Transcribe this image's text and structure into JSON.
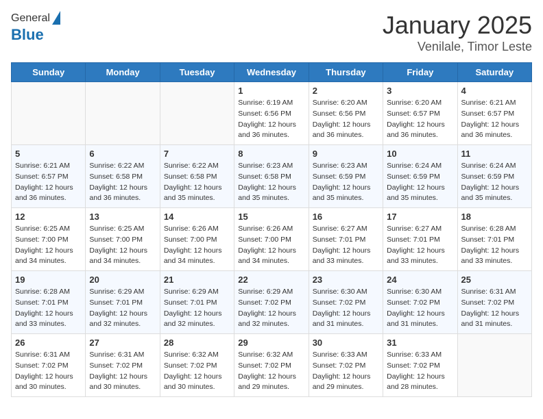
{
  "header": {
    "logo_line1": "General",
    "logo_line2": "Blue",
    "title": "January 2025",
    "subtitle": "Venilale, Timor Leste"
  },
  "weekdays": [
    "Sunday",
    "Monday",
    "Tuesday",
    "Wednesday",
    "Thursday",
    "Friday",
    "Saturday"
  ],
  "weeks": [
    [
      {
        "day": "",
        "info": ""
      },
      {
        "day": "",
        "info": ""
      },
      {
        "day": "",
        "info": ""
      },
      {
        "day": "1",
        "info": "Sunrise: 6:19 AM\nSunset: 6:56 PM\nDaylight: 12 hours\nand 36 minutes."
      },
      {
        "day": "2",
        "info": "Sunrise: 6:20 AM\nSunset: 6:56 PM\nDaylight: 12 hours\nand 36 minutes."
      },
      {
        "day": "3",
        "info": "Sunrise: 6:20 AM\nSunset: 6:57 PM\nDaylight: 12 hours\nand 36 minutes."
      },
      {
        "day": "4",
        "info": "Sunrise: 6:21 AM\nSunset: 6:57 PM\nDaylight: 12 hours\nand 36 minutes."
      }
    ],
    [
      {
        "day": "5",
        "info": "Sunrise: 6:21 AM\nSunset: 6:57 PM\nDaylight: 12 hours\nand 36 minutes."
      },
      {
        "day": "6",
        "info": "Sunrise: 6:22 AM\nSunset: 6:58 PM\nDaylight: 12 hours\nand 36 minutes."
      },
      {
        "day": "7",
        "info": "Sunrise: 6:22 AM\nSunset: 6:58 PM\nDaylight: 12 hours\nand 35 minutes."
      },
      {
        "day": "8",
        "info": "Sunrise: 6:23 AM\nSunset: 6:58 PM\nDaylight: 12 hours\nand 35 minutes."
      },
      {
        "day": "9",
        "info": "Sunrise: 6:23 AM\nSunset: 6:59 PM\nDaylight: 12 hours\nand 35 minutes."
      },
      {
        "day": "10",
        "info": "Sunrise: 6:24 AM\nSunset: 6:59 PM\nDaylight: 12 hours\nand 35 minutes."
      },
      {
        "day": "11",
        "info": "Sunrise: 6:24 AM\nSunset: 6:59 PM\nDaylight: 12 hours\nand 35 minutes."
      }
    ],
    [
      {
        "day": "12",
        "info": "Sunrise: 6:25 AM\nSunset: 7:00 PM\nDaylight: 12 hours\nand 34 minutes."
      },
      {
        "day": "13",
        "info": "Sunrise: 6:25 AM\nSunset: 7:00 PM\nDaylight: 12 hours\nand 34 minutes."
      },
      {
        "day": "14",
        "info": "Sunrise: 6:26 AM\nSunset: 7:00 PM\nDaylight: 12 hours\nand 34 minutes."
      },
      {
        "day": "15",
        "info": "Sunrise: 6:26 AM\nSunset: 7:00 PM\nDaylight: 12 hours\nand 34 minutes."
      },
      {
        "day": "16",
        "info": "Sunrise: 6:27 AM\nSunset: 7:01 PM\nDaylight: 12 hours\nand 33 minutes."
      },
      {
        "day": "17",
        "info": "Sunrise: 6:27 AM\nSunset: 7:01 PM\nDaylight: 12 hours\nand 33 minutes."
      },
      {
        "day": "18",
        "info": "Sunrise: 6:28 AM\nSunset: 7:01 PM\nDaylight: 12 hours\nand 33 minutes."
      }
    ],
    [
      {
        "day": "19",
        "info": "Sunrise: 6:28 AM\nSunset: 7:01 PM\nDaylight: 12 hours\nand 33 minutes."
      },
      {
        "day": "20",
        "info": "Sunrise: 6:29 AM\nSunset: 7:01 PM\nDaylight: 12 hours\nand 32 minutes."
      },
      {
        "day": "21",
        "info": "Sunrise: 6:29 AM\nSunset: 7:01 PM\nDaylight: 12 hours\nand 32 minutes."
      },
      {
        "day": "22",
        "info": "Sunrise: 6:29 AM\nSunset: 7:02 PM\nDaylight: 12 hours\nand 32 minutes."
      },
      {
        "day": "23",
        "info": "Sunrise: 6:30 AM\nSunset: 7:02 PM\nDaylight: 12 hours\nand 31 minutes."
      },
      {
        "day": "24",
        "info": "Sunrise: 6:30 AM\nSunset: 7:02 PM\nDaylight: 12 hours\nand 31 minutes."
      },
      {
        "day": "25",
        "info": "Sunrise: 6:31 AM\nSunset: 7:02 PM\nDaylight: 12 hours\nand 31 minutes."
      }
    ],
    [
      {
        "day": "26",
        "info": "Sunrise: 6:31 AM\nSunset: 7:02 PM\nDaylight: 12 hours\nand 30 minutes."
      },
      {
        "day": "27",
        "info": "Sunrise: 6:31 AM\nSunset: 7:02 PM\nDaylight: 12 hours\nand 30 minutes."
      },
      {
        "day": "28",
        "info": "Sunrise: 6:32 AM\nSunset: 7:02 PM\nDaylight: 12 hours\nand 30 minutes."
      },
      {
        "day": "29",
        "info": "Sunrise: 6:32 AM\nSunset: 7:02 PM\nDaylight: 12 hours\nand 29 minutes."
      },
      {
        "day": "30",
        "info": "Sunrise: 6:33 AM\nSunset: 7:02 PM\nDaylight: 12 hours\nand 29 minutes."
      },
      {
        "day": "31",
        "info": "Sunrise: 6:33 AM\nSunset: 7:02 PM\nDaylight: 12 hours\nand 28 minutes."
      },
      {
        "day": "",
        "info": ""
      }
    ]
  ]
}
